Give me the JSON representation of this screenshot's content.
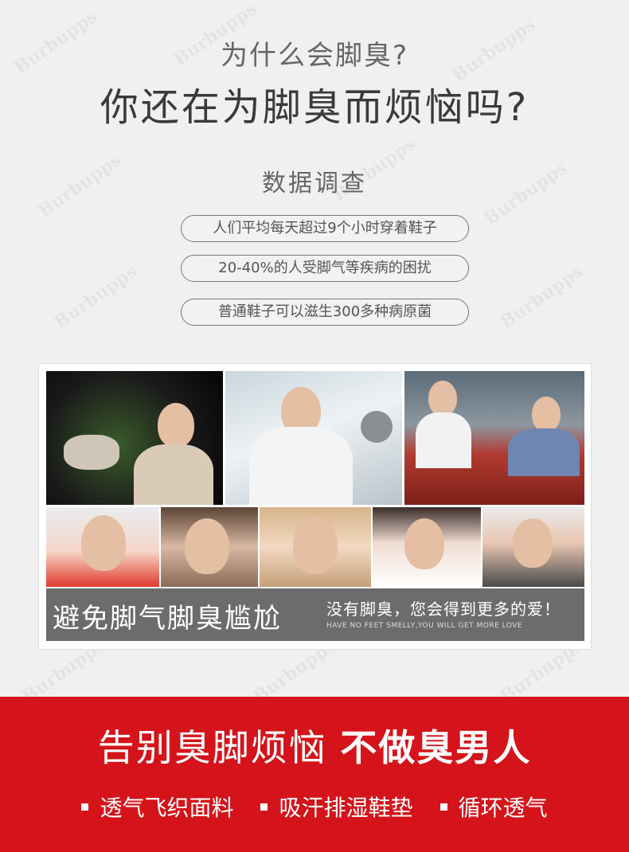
{
  "watermark": "Burbupps",
  "header": {
    "question_small": "为什么会脚臭?",
    "question_large": "你还在为脚臭而烦恼吗?"
  },
  "survey": {
    "title": "数据调查",
    "facts": [
      "人们平均每天超过9个小时穿着鞋子",
      "20-40%的人受脚气等疾病的困扰",
      "普通鞋子可以滋生300多种病原菌"
    ]
  },
  "photo_banner": {
    "main": "避免脚气脚臭尴尬",
    "sub": "没有脚臭，您会得到更多的爱！",
    "english": "HAVE NO FEET SMELLY,YOU WILL GET MORE LOVE"
  },
  "footer": {
    "slogan_light": "告别臭脚烦恼",
    "slogan_bold": "不做臭男人",
    "features": [
      "透气飞织面料",
      "吸汗排湿鞋垫",
      "循环透气"
    ]
  },
  "colors": {
    "background": "#f0f0f0",
    "accent_red": "#d4141a",
    "banner_gray": "#5f5f5f"
  }
}
